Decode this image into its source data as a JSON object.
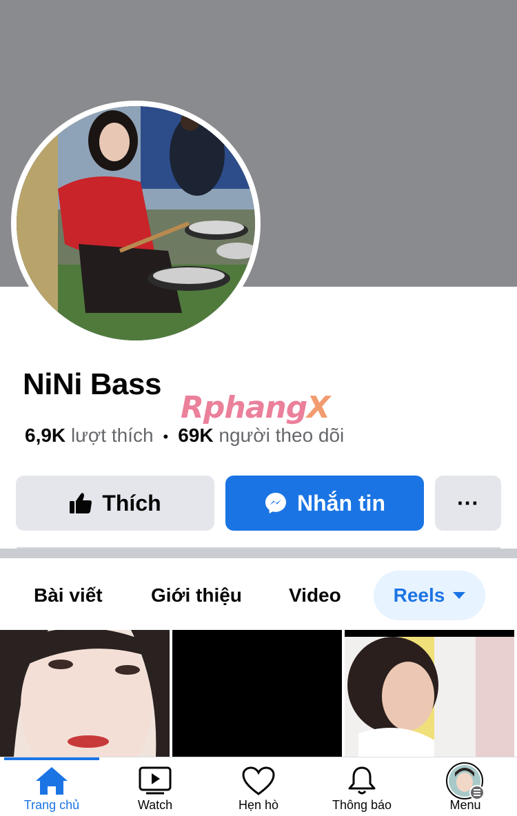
{
  "profile": {
    "name": "NiNi Bass",
    "likes_count": "6,9K",
    "likes_label": "lượt thích",
    "separator": "•",
    "followers_count": "69K",
    "followers_label": "người theo dõi"
  },
  "watermark": {
    "part1": "Rphang",
    "part2": "X"
  },
  "actions": {
    "like_label": "Thích",
    "message_label": "Nhắn tin",
    "more_label": "···"
  },
  "tabs": {
    "posts": "Bài viết",
    "about": "Giới thiệu",
    "video": "Video",
    "reels": "Reels"
  },
  "bottom_nav": {
    "home": "Trang chủ",
    "watch": "Watch",
    "dating": "Hẹn hò",
    "notifications": "Thông báo",
    "menu": "Menu"
  },
  "colors": {
    "brand_blue": "#1b74e4",
    "cover_gray": "#8a8b8f",
    "button_gray": "#e4e6eb"
  }
}
